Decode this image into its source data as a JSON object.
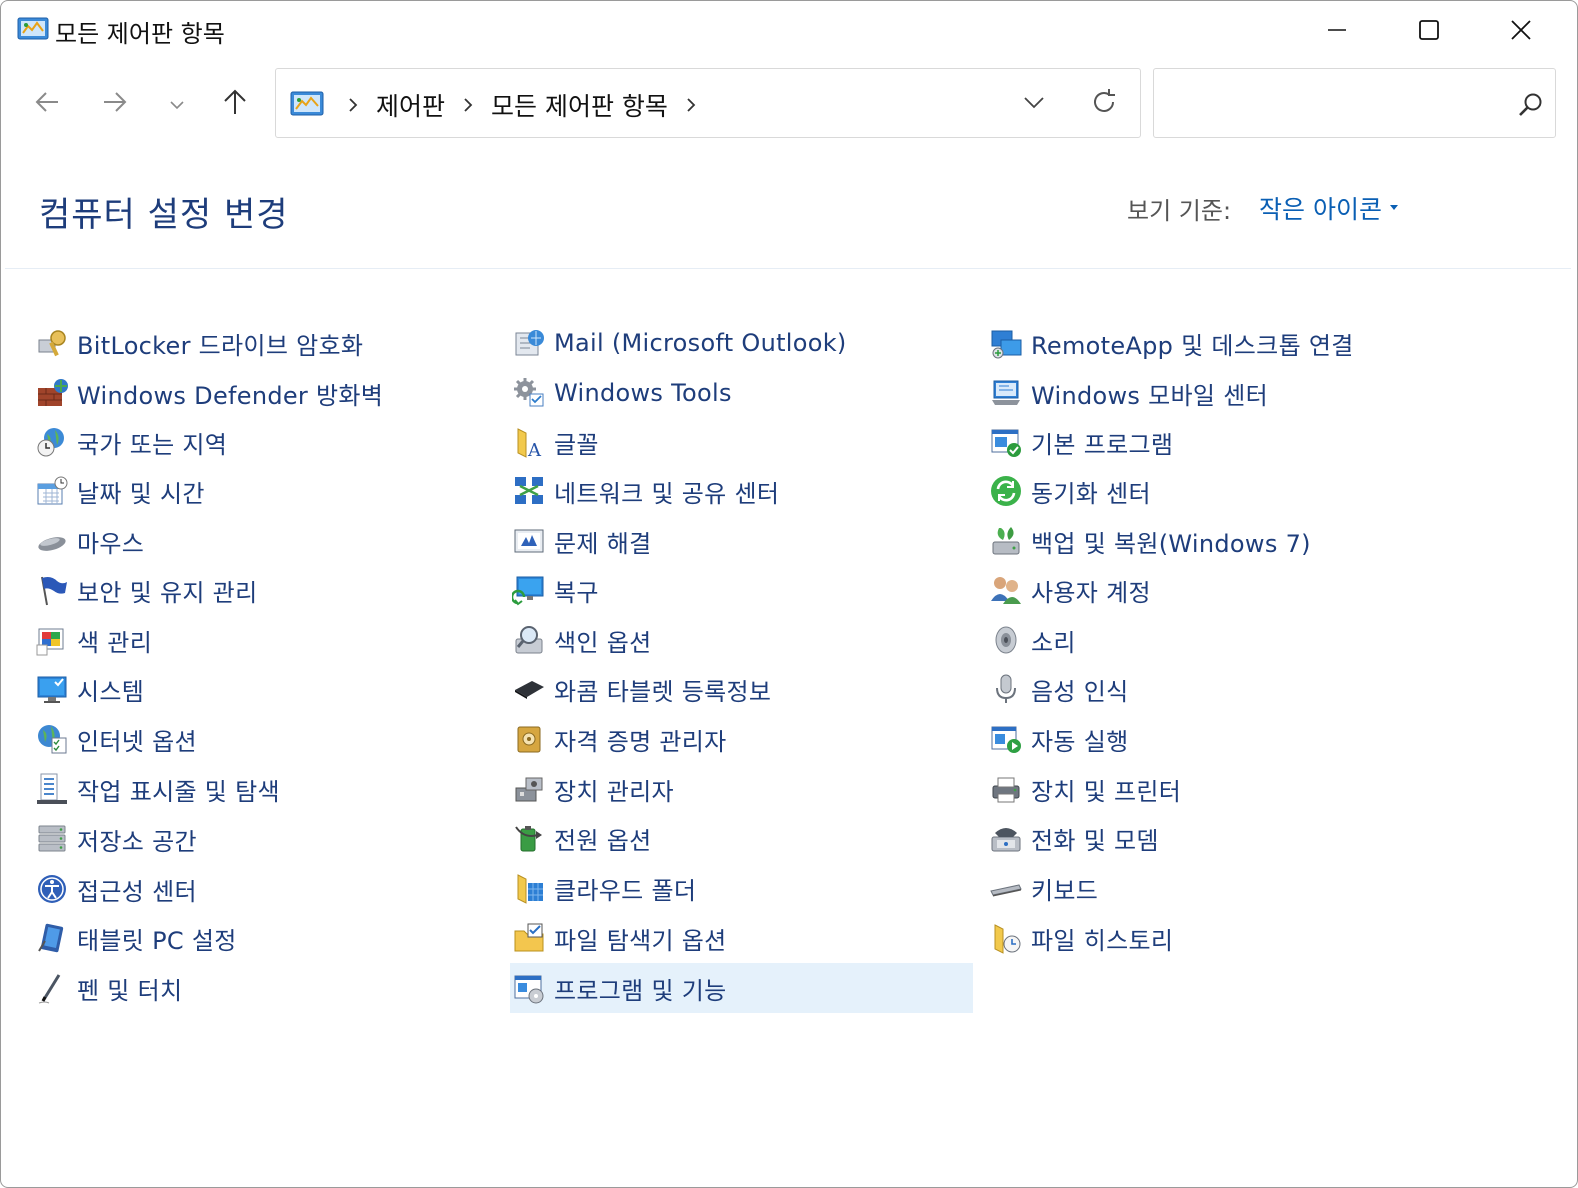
{
  "window": {
    "title": "모든 제어판 항목",
    "app_icon": "control-panel-icon",
    "controls": [
      "minimize",
      "maximize",
      "close"
    ]
  },
  "nav": {
    "back_icon": "arrow-left-icon",
    "forward_icon": "arrow-right-icon",
    "recent_icon": "chevron-down-icon",
    "up_icon": "arrow-up-icon"
  },
  "address": {
    "crumbs": [
      "제어판",
      "모든 제어판 항목"
    ],
    "refresh_icon": "refresh-icon",
    "dropdown_icon": "chevron-down-icon"
  },
  "search": {
    "value": "",
    "placeholder": "",
    "icon": "search-icon"
  },
  "header": {
    "title": "컴퓨터 설정 변경",
    "view_by_label": "보기 기준:",
    "view_by_value": "작은 아이콘"
  },
  "columns": [
    {
      "items": [
        {
          "label": "BitLocker 드라이브 암호화",
          "icon": "bitlocker-key-icon"
        },
        {
          "label": "Windows Defender 방화벽",
          "icon": "firewall-brick-icon"
        },
        {
          "label": "국가 또는 지역",
          "icon": "globe-clock-icon"
        },
        {
          "label": "날짜 및 시간",
          "icon": "calendar-clock-icon"
        },
        {
          "label": "마우스",
          "icon": "mouse-icon"
        },
        {
          "label": "보안 및 유지 관리",
          "icon": "flag-icon"
        },
        {
          "label": "색 관리",
          "icon": "color-management-icon"
        },
        {
          "label": "시스템",
          "icon": "monitor-check-icon"
        },
        {
          "label": "인터넷 옵션",
          "icon": "globe-checklist-icon"
        },
        {
          "label": "작업 표시줄 및 탐색",
          "icon": "taskbar-icon"
        },
        {
          "label": "저장소 공간",
          "icon": "storage-drives-icon"
        },
        {
          "label": "접근성 센터",
          "icon": "accessibility-icon"
        },
        {
          "label": "태블릿 PC 설정",
          "icon": "tablet-icon"
        },
        {
          "label": "펜 및 터치",
          "icon": "pen-icon"
        }
      ]
    },
    {
      "items": [
        {
          "label": "Mail (Microsoft Outlook)",
          "icon": "mail-icon"
        },
        {
          "label": "Windows Tools",
          "icon": "gears-icon"
        },
        {
          "label": "글꼴",
          "icon": "font-folder-icon"
        },
        {
          "label": "네트워크 및 공유 센터",
          "icon": "network-icon"
        },
        {
          "label": "문제 해결",
          "icon": "troubleshoot-icon"
        },
        {
          "label": "복구",
          "icon": "recovery-monitor-icon"
        },
        {
          "label": "색인 옵션",
          "icon": "indexing-magnifier-icon"
        },
        {
          "label": "와콤 타블렛 등록정보",
          "icon": "wacom-tablet-icon"
        },
        {
          "label": "자격 증명 관리자",
          "icon": "credential-vault-icon"
        },
        {
          "label": "장치 관리자",
          "icon": "device-manager-icon"
        },
        {
          "label": "전원 옵션",
          "icon": "power-battery-icon"
        },
        {
          "label": "클라우드 폴더",
          "icon": "cloud-folder-icon"
        },
        {
          "label": "파일 탐색기 옵션",
          "icon": "folder-options-icon"
        },
        {
          "label": "프로그램 및 기능",
          "icon": "programs-features-icon",
          "selected": true
        }
      ]
    },
    {
      "items": [
        {
          "label": "RemoteApp 및 데스크톱 연결",
          "icon": "remoteapp-icon"
        },
        {
          "label": "Windows 모바일 센터",
          "icon": "mobility-center-icon"
        },
        {
          "label": "기본 프로그램",
          "icon": "default-programs-icon"
        },
        {
          "label": "동기화 센터",
          "icon": "sync-icon"
        },
        {
          "label": "백업 및 복원(Windows 7)",
          "icon": "backup-restore-icon"
        },
        {
          "label": "사용자 계정",
          "icon": "user-accounts-icon"
        },
        {
          "label": "소리",
          "icon": "speaker-icon"
        },
        {
          "label": "음성 인식",
          "icon": "microphone-icon"
        },
        {
          "label": "자동 실행",
          "icon": "autoplay-icon"
        },
        {
          "label": "장치 및 프린터",
          "icon": "printer-icon"
        },
        {
          "label": "전화 및 모뎀",
          "icon": "phone-modem-icon"
        },
        {
          "label": "키보드",
          "icon": "keyboard-icon"
        },
        {
          "label": "파일 히스토리",
          "icon": "file-history-icon"
        }
      ]
    }
  ],
  "colors": {
    "link": "#1e3d7b",
    "accent": "#0a5fb4",
    "selected_bg": "#e5f1fb"
  }
}
